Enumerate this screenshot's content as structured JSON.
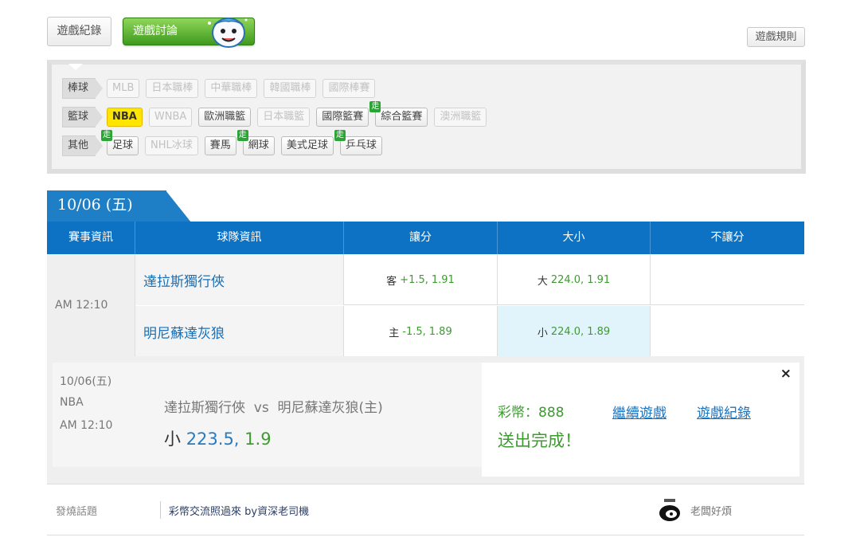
{
  "top": {
    "record_btn": "遊戲紀錄",
    "discuss_btn": "遊戲討論",
    "rules_btn": "遊戲規則"
  },
  "categories": {
    "baseball": {
      "label": "棒球",
      "leagues": [
        {
          "name": "MLB",
          "state": "off"
        },
        {
          "name": "日本職棒",
          "state": "off"
        },
        {
          "name": "中華職棒",
          "state": "off"
        },
        {
          "name": "韓國職棒",
          "state": "off"
        },
        {
          "name": "國際棒賽",
          "state": "off"
        }
      ]
    },
    "basketball": {
      "label": "籃球",
      "leagues": [
        {
          "name": "NBA",
          "state": "selected"
        },
        {
          "name": "WNBA",
          "state": "off"
        },
        {
          "name": "歐洲職籃",
          "state": "on"
        },
        {
          "name": "日本職籃",
          "state": "off"
        },
        {
          "name": "國際籃賽",
          "state": "on"
        },
        {
          "name": "綜合籃賽",
          "state": "on",
          "live": "走"
        },
        {
          "name": "澳洲職籃",
          "state": "off"
        }
      ]
    },
    "other": {
      "label": "其他",
      "leagues": [
        {
          "name": "足球",
          "state": "on",
          "live": "走"
        },
        {
          "name": "NHL冰球",
          "state": "off"
        },
        {
          "name": "賽馬",
          "state": "on"
        },
        {
          "name": "網球",
          "state": "on",
          "live": "走"
        },
        {
          "name": "美式足球",
          "state": "on"
        },
        {
          "name": "乒乓球",
          "state": "on",
          "live": "走"
        }
      ]
    }
  },
  "date_tab": "10/06 (五)",
  "table": {
    "headers": [
      "賽事資訊",
      "球隊資訊",
      "讓分",
      "大小",
      "不讓分"
    ],
    "time": "AM 12:10",
    "rows": [
      {
        "team": "達拉斯獨行俠",
        "spread_side": "客",
        "spread": "+1.5,",
        "spread_odds": "1.91",
        "total_side": "大",
        "total": "224.0,",
        "total_odds": "1.91"
      },
      {
        "team": "明尼蘇達灰狼",
        "spread_side": "主",
        "spread": "-1.5,",
        "spread_odds": "1.89",
        "total_side": "小",
        "total": "224.0,",
        "total_odds": "1.89"
      }
    ]
  },
  "slip": {
    "date": "10/06(五)",
    "league": "NBA",
    "time": "AM 12:10",
    "matchup": "達拉斯獨行俠  vs  明尼蘇達灰狼(主)",
    "pick_side": "小",
    "pick_line": "223.5,",
    "pick_odds": "1.9",
    "coins": "彩幣：888",
    "sent": "送出完成！",
    "continue_link": "繼續遊戲",
    "record_link": "遊戲紀錄",
    "close": "×"
  },
  "footer": {
    "label": "發燒話題",
    "topic": "彩幣交流照過來 by資深老司機",
    "right": "老闆好煩"
  },
  "colors": {
    "header_blue": "#0d72c3",
    "accent_green": "#3f9a1e",
    "selected_yellow": "#ffe600",
    "odds_green": "#3d9b30",
    "link_blue": "#1e73bd"
  }
}
